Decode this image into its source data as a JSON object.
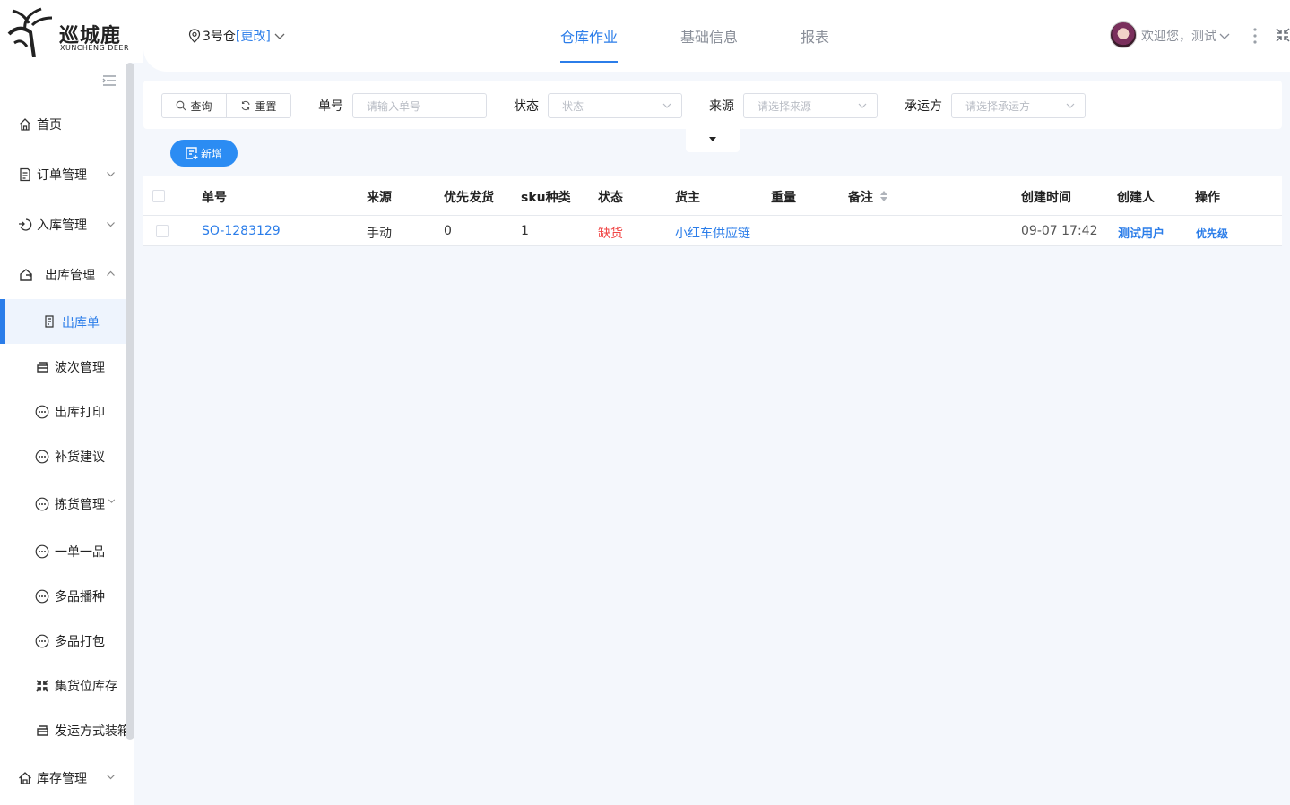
{
  "brand": {
    "title": "巡城鹿",
    "subtitle": "XUNCHENG DEER"
  },
  "header": {
    "warehouse": "3号仓",
    "change_link": "[更改]",
    "tabs": [
      {
        "label": "仓库作业",
        "active": true
      },
      {
        "label": "基础信息",
        "active": false
      },
      {
        "label": "报表",
        "active": false
      }
    ],
    "welcome": "欢迎您，测试"
  },
  "sidebar": {
    "items": [
      {
        "label": "首页",
        "icon": "home-icon"
      },
      {
        "label": "订单管理",
        "icon": "order-icon",
        "expandable": true
      },
      {
        "label": "入库管理",
        "icon": "inbound-icon",
        "expandable": true
      },
      {
        "label": "出库管理",
        "icon": "outbound-icon",
        "expandable": true,
        "expanded": true
      },
      {
        "label": "出库单",
        "icon": "doc-icon",
        "active": true
      },
      {
        "label": "波次管理",
        "icon": "box-icon"
      },
      {
        "label": "出库打印",
        "icon": "dots-icon"
      },
      {
        "label": "补货建议",
        "icon": "dots-icon"
      },
      {
        "label": "拣货管理",
        "icon": "dots-icon",
        "expandable": true
      },
      {
        "label": "一单一品",
        "icon": "dots-icon"
      },
      {
        "label": "多品播种",
        "icon": "dots-icon"
      },
      {
        "label": "多品打包",
        "icon": "dots-icon"
      },
      {
        "label": "集货位库存",
        "icon": "collect-icon"
      },
      {
        "label": "发运方式装箱",
        "icon": "box-icon"
      },
      {
        "label": "库存管理",
        "icon": "stock-icon",
        "expandable": true
      }
    ]
  },
  "filters": {
    "query_btn": "查询",
    "reset_btn": "重置",
    "order_no_label": "单号",
    "order_no_placeholder": "请输入单号",
    "status_label": "状态",
    "status_placeholder": "状态",
    "source_label": "来源",
    "source_placeholder": "请选择来源",
    "carrier_label": "承运方",
    "carrier_placeholder": "请选择承运方"
  },
  "toolbar": {
    "add_label": "新增"
  },
  "table": {
    "columns": [
      "单号",
      "来源",
      "优先发货",
      "sku种类",
      "状态",
      "货主",
      "重量",
      "备注",
      "创建时间",
      "创建人",
      "操作"
    ],
    "rows": [
      {
        "order_no": "SO-1283129",
        "source": "手动",
        "priority": "0",
        "sku_types": "1",
        "status": "缺货",
        "owner": "小红车供应链",
        "weight": "",
        "remark": "",
        "created_at": "09-07 17:42",
        "creator": "测试用户",
        "action": "优先级"
      }
    ]
  },
  "colors": {
    "accent": "#2b7de9",
    "danger": "#f04646",
    "background": "#f4f7fc"
  }
}
